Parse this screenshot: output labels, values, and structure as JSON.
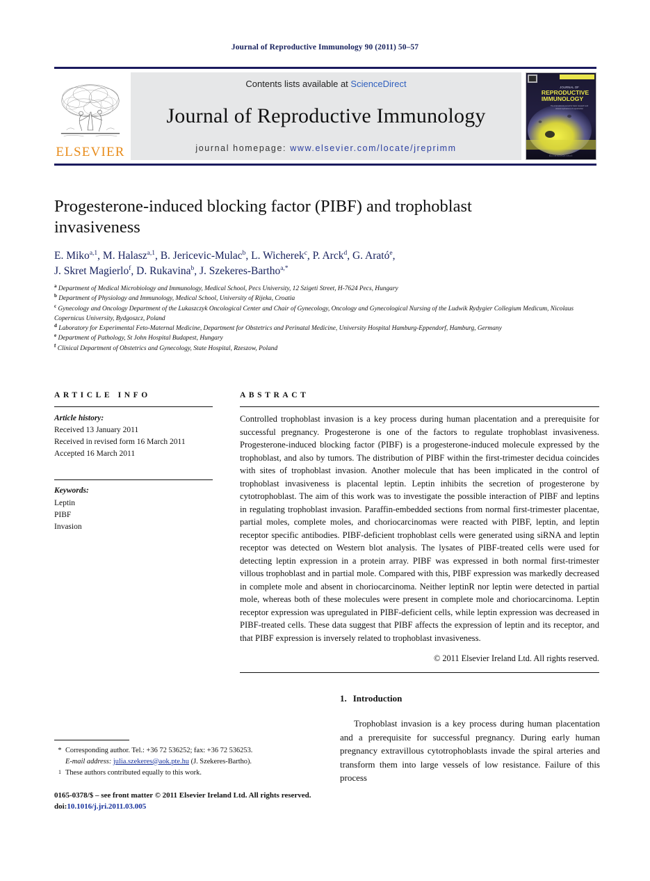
{
  "running_head": "Journal of Reproductive Immunology 90 (2011) 50–57",
  "masthead": {
    "contents_prefix": "Contents lists available at ",
    "sciencedirect": "ScienceDirect",
    "journal_name": "Journal of Reproductive Immunology",
    "homepage_label": "journal homepage:",
    "homepage_url": "www.elsevier.com/locate/jreprimm",
    "publisher_wordmark": "ELSEVIER",
    "publisher_color": "#e88c1b",
    "rule_color": "#1a1a5e",
    "banner_bg": "#e6e7e8",
    "cover": {
      "line1": "JOURNAL OF",
      "line2": "REPRODUCTIVE",
      "line3": "IMMUNOLOGY",
      "tagline": "The international journal for basic research and clinical implications of reproduction"
    }
  },
  "article": {
    "title": "Progesterone-induced blocking factor (PIBF) and trophoblast invasiveness",
    "authors_line_1": "E. Miko",
    "authors": [
      {
        "name": "E. Miko",
        "marks": "a,1",
        "sep": ", "
      },
      {
        "name": "M. Halasz",
        "marks": "a,1",
        "sep": ", "
      },
      {
        "name": "B. Jericevic-Mulac",
        "marks": "b",
        "sep": ", "
      },
      {
        "name": "L. Wicherek",
        "marks": "c",
        "sep": ", "
      },
      {
        "name": "P. Arck",
        "marks": "d",
        "sep": ", "
      },
      {
        "name": "G. Arató",
        "marks": "e",
        "sep": ","
      },
      {
        "name": "J. Skret Magierlo",
        "marks": "f",
        "sep": ", "
      },
      {
        "name": "D. Rukavina",
        "marks": "b",
        "sep": ", "
      },
      {
        "name": "J. Szekeres-Bartho",
        "marks": "a,*",
        "sep": ""
      }
    ],
    "author_color": "#16205c",
    "affiliations": [
      {
        "mark": "a",
        "text": "Department of Medical Microbiology and Immunology, Medical School, Pecs University, 12 Szigeti Street, H-7624 Pecs, Hungary"
      },
      {
        "mark": "b",
        "text": "Department of Physiology and Immunology, Medical School, University of Rijeka, Croatia"
      },
      {
        "mark": "c",
        "text": "Gynecology and Oncology Department of the Lukaszczyk Oncological Center and Chair of Gynecology, Oncology and Gynecological Nursing of the Ludwik Rydygier Collegium Medicum, Nicolaus Copernicus University, Bydgoszcz, Poland"
      },
      {
        "mark": "d",
        "text": "Laboratory for Experimental Feto-Maternal Medicine, Department for Obstetrics and Perinatal Medicine, University Hospital Hamburg-Eppendorf, Hamburg, Germany"
      },
      {
        "mark": "e",
        "text": "Department of Pathology, St John Hospital Budapest, Hungary"
      },
      {
        "mark": "f",
        "text": "Clinical Department of Obstetrics and Gynecology, State Hospital, Rzeszow, Poland"
      }
    ]
  },
  "article_info": {
    "heading": "ARTICLE INFO",
    "history_label": "Article history:",
    "history": [
      "Received 13 January 2011",
      "Received in revised form 16 March 2011",
      "Accepted 16 March 2011"
    ],
    "keywords_label": "Keywords:",
    "keywords": [
      "Leptin",
      "PIBF",
      "Invasion"
    ]
  },
  "abstract": {
    "heading": "ABSTRACT",
    "text": "Controlled trophoblast invasion is a key process during human placentation and a prerequisite for successful pregnancy. Progesterone is one of the factors to regulate trophoblast invasiveness. Progesterone-induced blocking factor (PIBF) is a progesterone-induced molecule expressed by the trophoblast, and also by tumors. The distribution of PIBF within the first-trimester decidua coincides with sites of trophoblast invasion. Another molecule that has been implicated in the control of trophoblast invasiveness is placental leptin. Leptin inhibits the secretion of progesterone by cytotrophoblast. The aim of this work was to investigate the possible interaction of PIBF and leptins in regulating trophoblast invasion. Paraffin-embedded sections from normal first-trimester placentae, partial moles, complete moles, and choriocarcinomas were reacted with PIBF, leptin, and leptin receptor specific antibodies. PIBF-deficient trophoblast cells were generated using siRNA and leptin receptor was detected on Western blot analysis. The lysates of PIBF-treated cells were used for detecting leptin expression in a protein array. PIBF was expressed in both normal first-trimester villous trophoblast and in partial mole. Compared with this, PIBF expression was markedly decreased in complete mole and absent in choriocarcinoma. Neither leptinR nor leptin were detected in partial mole, whereas both of these molecules were present in complete mole and choriocarcinoma. Leptin receptor expression was upregulated in PIBF-deficient cells, while leptin expression was decreased in PIBF-treated cells. These data suggest that PIBF affects the expression of leptin and its receptor, and that PIBF expression is inversely related to trophoblast invasiveness.",
    "copyright": "© 2011 Elsevier Ireland Ltd. All rights reserved."
  },
  "introduction": {
    "number": "1.",
    "heading": "Introduction",
    "paragraph": "Trophoblast invasion is a key process during human placentation and a prerequisite for successful pregnancy. During early human pregnancy extravillous cytotrophoblasts invade the spiral arteries and transform them into large vessels of low resistance. Failure of this process"
  },
  "footnotes": {
    "corresponding": {
      "mark": "*",
      "text": "Corresponding author. Tel.: +36 72 536252; fax: +36 72 536253.",
      "email_label": "E-mail address:",
      "email": "julia.szekeres@aok.pte.hu",
      "email_suffix": "(J. Szekeres-Bartho).",
      "link_color": "#16309b"
    },
    "equal_contribution": {
      "mark": "1",
      "text": "These authors contributed equally to this work."
    }
  },
  "imprint": {
    "line1": "0165-0378/$ – see front matter © 2011 Elsevier Ireland Ltd. All rights reserved.",
    "doi_label": "doi:",
    "doi_value": "10.1016/j.jri.2011.03.005"
  }
}
